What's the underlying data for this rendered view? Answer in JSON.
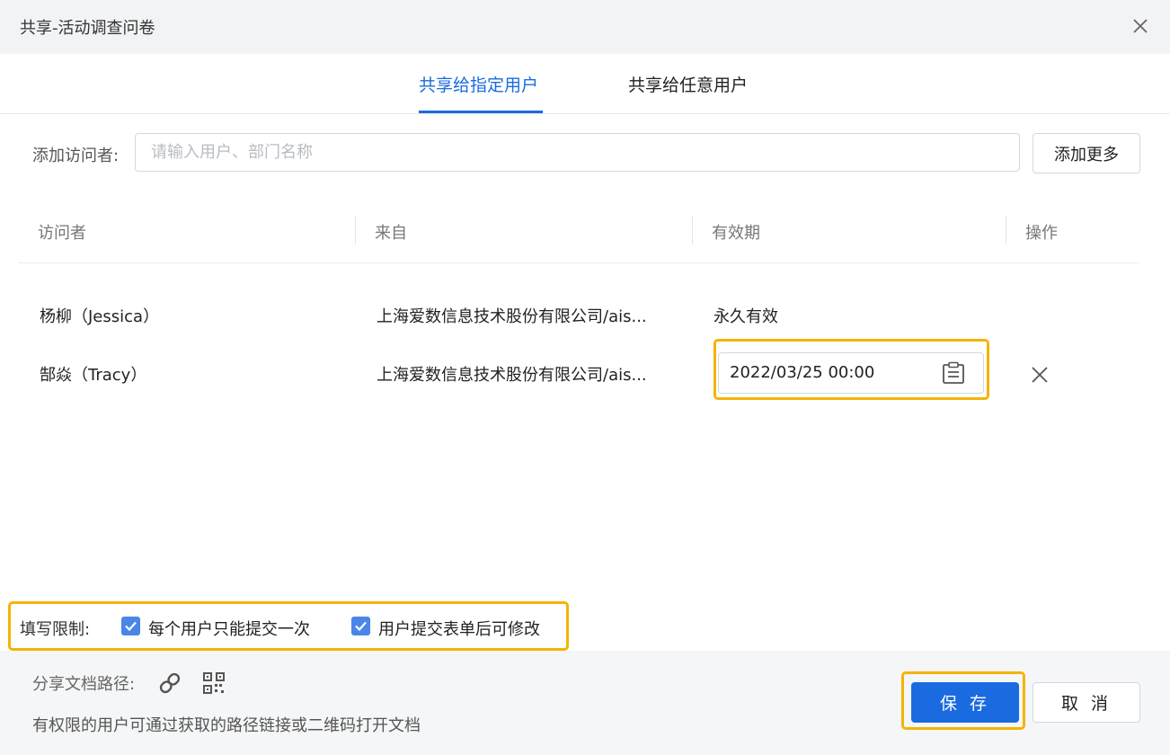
{
  "dialog": {
    "title": "共享-活动调查问卷"
  },
  "tabs": [
    {
      "label": "共享给指定用户",
      "active": true
    },
    {
      "label": "共享给任意用户",
      "active": false
    }
  ],
  "add_visitor": {
    "label": "添加访问者:",
    "placeholder": "请输入用户、部门名称",
    "add_more_label": "添加更多"
  },
  "table": {
    "headers": [
      "访问者",
      "来自",
      "有效期",
      "操作"
    ],
    "rows": [
      {
        "visitor": "杨柳（Jessica）",
        "from": "上海爱数信息技术股份有限公司/ais...",
        "validity": "永久有效"
      },
      {
        "visitor": "郜焱（Tracy）",
        "from": "上海爱数信息技术股份有限公司/ais...",
        "validity": "2022/03/25 00:00"
      }
    ]
  },
  "restriction": {
    "label": "填写限制:",
    "options": [
      {
        "label": "每个用户只能提交一次",
        "checked": true
      },
      {
        "label": "用户提交表单后可修改",
        "checked": true
      }
    ]
  },
  "footer": {
    "share_path_label": "分享文档路径:",
    "note": "有权限的用户可通过获取的路径链接或二维码打开文档",
    "save_label": "保 存",
    "cancel_label": "取 消"
  },
  "colors": {
    "accent": "#1a6be0",
    "highlight": "#f4b400",
    "checkbox": "#4a86e8"
  },
  "icons": [
    "close-icon",
    "calendar-icon",
    "remove-icon",
    "checkbox-checked-icon",
    "link-icon",
    "qrcode-icon"
  ]
}
